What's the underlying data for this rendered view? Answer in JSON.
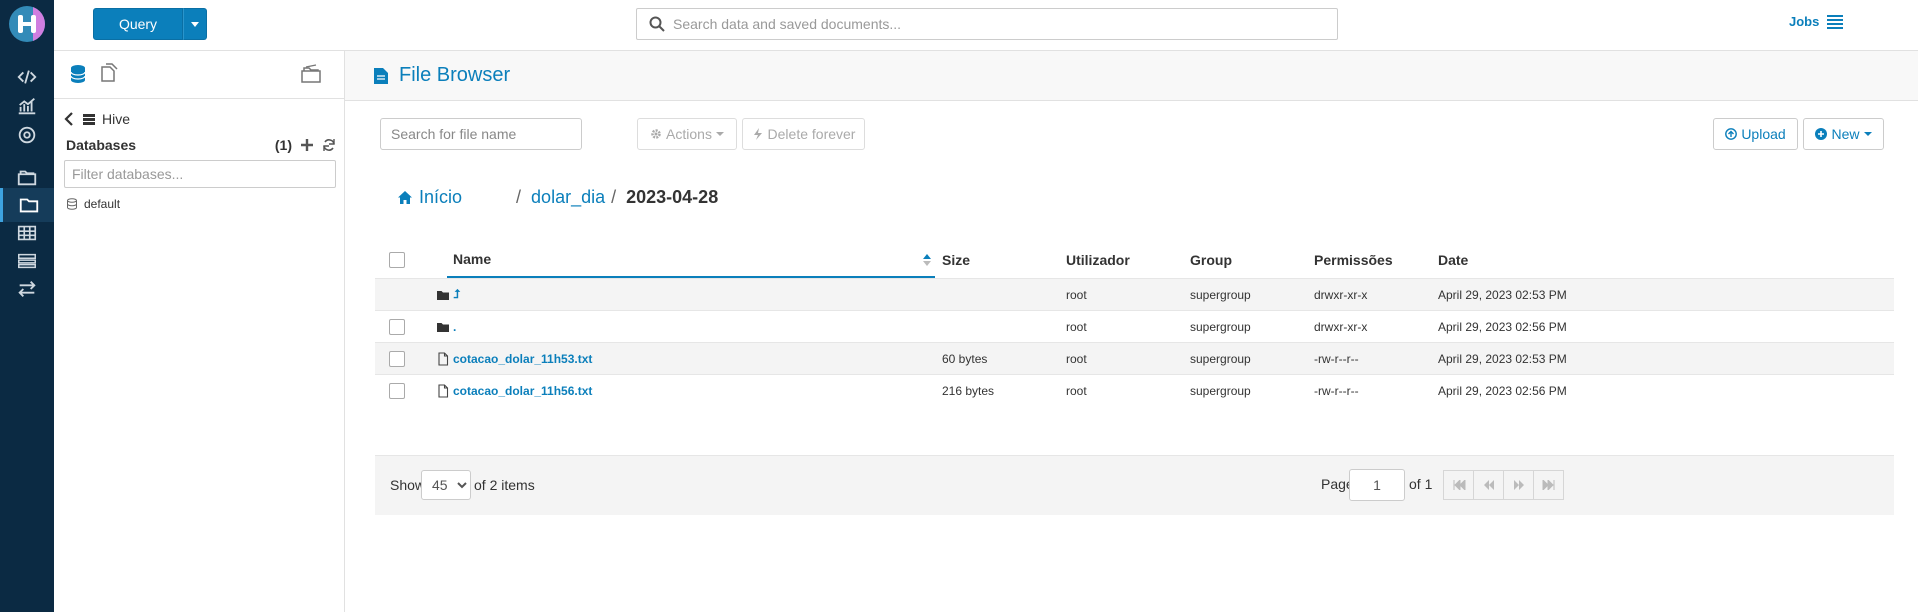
{
  "topbar": {
    "query_label": "Query",
    "search_placeholder": "Search data and saved documents...",
    "jobs_label": "Jobs"
  },
  "left_panel": {
    "source": "Hive",
    "databases_label": "Databases",
    "databases_count": "(1)",
    "filter_placeholder": "Filter databases...",
    "databases": [
      "default"
    ]
  },
  "main": {
    "title": "File Browser",
    "file_search_placeholder": "Search for file name",
    "actions_label": "Actions",
    "delete_label": "Delete forever",
    "upload_label": "Upload",
    "new_label": "New",
    "breadcrumb": {
      "home": "Início",
      "folder": "dolar_dia",
      "current": "2023-04-28"
    },
    "columns": {
      "name": "Name",
      "size": "Size",
      "user": "Utilizador",
      "group": "Group",
      "perm": "Permissões",
      "date": "Date"
    },
    "rows": [
      {
        "type": "folder",
        "name": "⮥",
        "size": "",
        "user": "root",
        "group": "supergroup",
        "perm": "drwxr-xr-x",
        "date": "April 29, 2023 02:53 PM"
      },
      {
        "type": "folder",
        "name": ".",
        "size": "",
        "user": "root",
        "group": "supergroup",
        "perm": "drwxr-xr-x",
        "date": "April 29, 2023 02:56 PM"
      },
      {
        "type": "file",
        "name": "cotacao_dolar_11h53.txt",
        "size": "60 bytes",
        "user": "root",
        "group": "supergroup",
        "perm": "-rw-r--r--",
        "date": "April 29, 2023 02:53 PM"
      },
      {
        "type": "file",
        "name": "cotacao_dolar_11h56.txt",
        "size": "216 bytes",
        "user": "root",
        "group": "supergroup",
        "perm": "-rw-r--r--",
        "date": "April 29, 2023 02:56 PM"
      }
    ],
    "footer": {
      "show_label": "Show",
      "page_size": "45",
      "of_items": "of 2 items",
      "page_label": "Page",
      "page_value": "1",
      "of_pages": "of 1"
    }
  },
  "colors": {
    "accent": "#0b7fbb",
    "rail": "#0b2a43"
  }
}
